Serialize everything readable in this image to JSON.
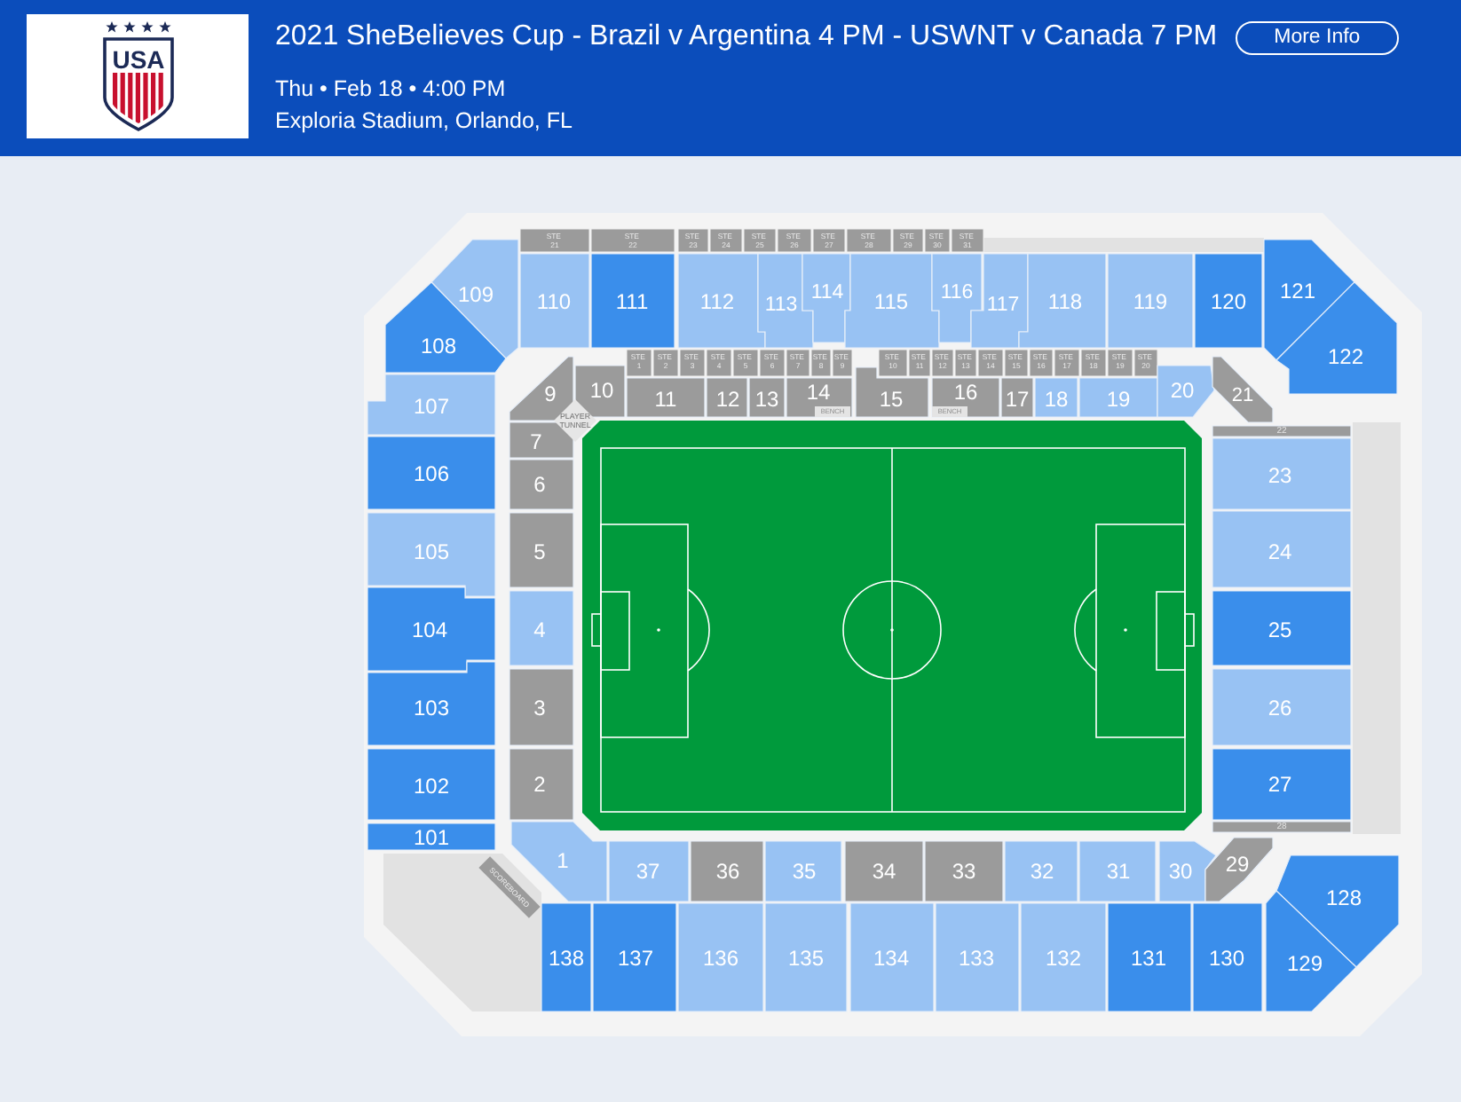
{
  "header": {
    "logo": {
      "text": "USA"
    },
    "title": "2021 SheBelieves Cup - Brazil v Argentina 4 PM - USWNT v Canada 7 PM",
    "more_info_button": "More Info",
    "date_line": "Thu • Feb 18 • 4:00 PM",
    "venue": "Exploria Stadium, Orlando, FL"
  },
  "map": {
    "upper_suites": [
      {
        "label": "STE",
        "number": "21"
      },
      {
        "label": "STE",
        "number": "22"
      },
      {
        "label": "STE",
        "number": "23"
      },
      {
        "label": "STE",
        "number": "24"
      },
      {
        "label": "STE",
        "number": "25"
      },
      {
        "label": "STE",
        "number": "26"
      },
      {
        "label": "STE",
        "number": "27"
      },
      {
        "label": "STE",
        "number": "28"
      },
      {
        "label": "STE",
        "number": "29"
      },
      {
        "label": "STE",
        "number": "30"
      },
      {
        "label": "STE",
        "number": "31"
      }
    ],
    "field_suites": [
      {
        "label": "STE",
        "number": "1"
      },
      {
        "label": "STE",
        "number": "2"
      },
      {
        "label": "STE",
        "number": "3"
      },
      {
        "label": "STE",
        "number": "4"
      },
      {
        "label": "STE",
        "number": "5"
      },
      {
        "label": "STE",
        "number": "6"
      },
      {
        "label": "STE",
        "number": "7"
      },
      {
        "label": "STE",
        "number": "8"
      },
      {
        "label": "STE",
        "number": "9"
      },
      {
        "label": "STE",
        "number": "10"
      },
      {
        "label": "STE",
        "number": "11"
      },
      {
        "label": "STE",
        "number": "12"
      },
      {
        "label": "STE",
        "number": "13"
      },
      {
        "label": "STE",
        "number": "14"
      },
      {
        "label": "STE",
        "number": "15"
      },
      {
        "label": "STE",
        "number": "16"
      },
      {
        "label": "STE",
        "number": "17"
      },
      {
        "label": "STE",
        "number": "18"
      },
      {
        "label": "STE",
        "number": "19"
      },
      {
        "label": "STE",
        "number": "20"
      }
    ],
    "sections": [
      {
        "label": "109",
        "color": "#98c2f3"
      },
      {
        "label": "110",
        "color": "#98c2f3"
      },
      {
        "label": "111",
        "color": "#3a8eeb"
      },
      {
        "label": "112",
        "color": "#98c2f3"
      },
      {
        "label": "113",
        "color": "#98c2f3"
      },
      {
        "label": "114",
        "color": "#98c2f3"
      },
      {
        "label": "115",
        "color": "#98c2f3"
      },
      {
        "label": "116",
        "color": "#98c2f3"
      },
      {
        "label": "117",
        "color": "#98c2f3"
      },
      {
        "label": "118",
        "color": "#98c2f3"
      },
      {
        "label": "119",
        "color": "#98c2f3"
      },
      {
        "label": "120",
        "color": "#3a8eeb"
      },
      {
        "label": "121",
        "color": "#3a8eeb"
      },
      {
        "label": "122",
        "color": "#3a8eeb"
      },
      {
        "label": "108",
        "color": "#3a8eeb"
      },
      {
        "label": "9",
        "color": "#9b9b9b"
      },
      {
        "label": "10",
        "color": "#9b9b9b"
      },
      {
        "label": "11",
        "color": "#9b9b9b"
      },
      {
        "label": "12",
        "color": "#9b9b9b"
      },
      {
        "label": "13",
        "color": "#9b9b9b"
      },
      {
        "label": "14",
        "color": "#9b9b9b"
      },
      {
        "label": "15",
        "color": "#9b9b9b"
      },
      {
        "label": "16",
        "color": "#9b9b9b"
      },
      {
        "label": "17",
        "color": "#9b9b9b"
      },
      {
        "label": "18",
        "color": "#98c2f3"
      },
      {
        "label": "19",
        "color": "#98c2f3"
      },
      {
        "label": "20",
        "color": "#98c2f3"
      },
      {
        "label": "21",
        "color": "#9b9b9b"
      },
      {
        "label": "107",
        "color": "#98c2f3"
      },
      {
        "label": "7",
        "color": "#9b9b9b"
      },
      {
        "label": "22",
        "color": "#9b9b9b"
      },
      {
        "label": "106",
        "color": "#3a8eeb"
      },
      {
        "label": "6",
        "color": "#9b9b9b"
      },
      {
        "label": "23",
        "color": "#98c2f3"
      },
      {
        "label": "105",
        "color": "#98c2f3"
      },
      {
        "label": "5",
        "color": "#9b9b9b"
      },
      {
        "label": "24",
        "color": "#98c2f3"
      },
      {
        "label": "104",
        "color": "#3a8eeb"
      },
      {
        "label": "4",
        "color": "#98c2f3"
      },
      {
        "label": "25",
        "color": "#3a8eeb"
      },
      {
        "label": "103",
        "color": "#3a8eeb"
      },
      {
        "label": "3",
        "color": "#9b9b9b"
      },
      {
        "label": "26",
        "color": "#98c2f3"
      },
      {
        "label": "102",
        "color": "#3a8eeb"
      },
      {
        "label": "2",
        "color": "#9b9b9b"
      },
      {
        "label": "27",
        "color": "#3a8eeb"
      },
      {
        "label": "101",
        "color": "#3a8eeb"
      },
      {
        "label": "28",
        "color": "#9b9b9b"
      },
      {
        "label": "1",
        "color": "#98c2f3"
      },
      {
        "label": "37",
        "color": "#98c2f3"
      },
      {
        "label": "36",
        "color": "#9b9b9b"
      },
      {
        "label": "35",
        "color": "#98c2f3"
      },
      {
        "label": "34",
        "color": "#9b9b9b"
      },
      {
        "label": "33",
        "color": "#9b9b9b"
      },
      {
        "label": "32",
        "color": "#98c2f3"
      },
      {
        "label": "31",
        "color": "#98c2f3"
      },
      {
        "label": "30",
        "color": "#98c2f3"
      },
      {
        "label": "29",
        "color": "#9b9b9b"
      },
      {
        "label": "128",
        "color": "#3a8eeb"
      },
      {
        "label": "138",
        "color": "#3a8eeb"
      },
      {
        "label": "137",
        "color": "#3a8eeb"
      },
      {
        "label": "136",
        "color": "#98c2f3"
      },
      {
        "label": "135",
        "color": "#98c2f3"
      },
      {
        "label": "134",
        "color": "#98c2f3"
      },
      {
        "label": "133",
        "color": "#98c2f3"
      },
      {
        "label": "132",
        "color": "#98c2f3"
      },
      {
        "label": "131",
        "color": "#3a8eeb"
      },
      {
        "label": "130",
        "color": "#3a8eeb"
      },
      {
        "label": "129",
        "color": "#3a8eeb"
      }
    ],
    "benches": [
      "BENCH",
      "BENCH"
    ],
    "player_tunnel": "PLAYER TUNNEL",
    "scoreboard": "SCOREBOARD"
  }
}
